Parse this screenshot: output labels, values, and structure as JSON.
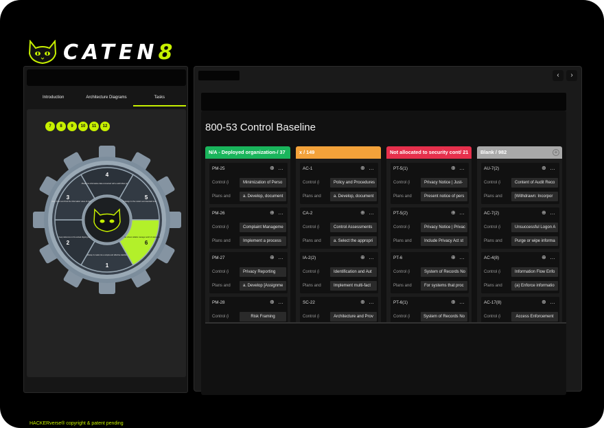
{
  "brand": {
    "name": "CATEN",
    "eight": "8"
  },
  "left_tabs": [
    "Introduction",
    "Architecture Diagrams",
    "Tasks"
  ],
  "steps": [
    "7",
    "8",
    "9",
    "10",
    "11",
    "12"
  ],
  "gear": {
    "segments": [
      {
        "num": "1",
        "text": "A tabletop & made into a simple and effective dashboard"
      },
      {
        "num": "2",
        "text": "Keep reference to the actual clipping canvas"
      },
      {
        "num": "3",
        "text": "Use, Count and Find the information value of component level"
      },
      {
        "num": "4",
        "text": "Please be informative data connected with a well follow practices"
      },
      {
        "num": "5",
        "text": "Digital design to the modern and standard tune"
      },
      {
        "num": "6",
        "text": "Create to the robust reliable manage world of relevance"
      }
    ]
  },
  "footer": "HACKERverse® copyright & patent pending",
  "nav": {
    "prev": "‹",
    "next": "›"
  },
  "baseline": {
    "title": "800-53 Control Baseline"
  },
  "colors": {
    "accent": "#c7f000",
    "green": "#1db954",
    "orange": "#f0a030",
    "red": "#e8344e",
    "gray": "#a8a8a8"
  },
  "columns": [
    {
      "title": "N/A - Deployed organization-/ 37",
      "color": "#1ab55c",
      "cards": [
        {
          "id": "PM-25",
          "control_label": "Control (i",
          "control": "Minimization of Perso",
          "plans_label": "Plans and",
          "plans": "a. Develop, document"
        },
        {
          "id": "PM-26",
          "control_label": "Control (i",
          "control": "Complaint Manageme",
          "plans_label": "Plans and",
          "plans": "Implement a process"
        },
        {
          "id": "PM-27",
          "control_label": "Control (i",
          "control": "Privacy Reporting",
          "plans_label": "Plans and",
          "plans": "a. Develop [Assignme"
        },
        {
          "id": "PM-28",
          "control_label": "Control (i",
          "control": "Risk Framing",
          "plans_label": "",
          "plans": ""
        }
      ]
    },
    {
      "title": "x / 149",
      "color": "#f3a23a",
      "cards": [
        {
          "id": "AC-1",
          "control_label": "Control (i",
          "control": "Policy and Procedures",
          "plans_label": "Plans and",
          "plans": "a. Develop, document"
        },
        {
          "id": "CA-2",
          "control_label": "Control (i",
          "control": "Control Assessments",
          "plans_label": "Plans and",
          "plans": "a. Select the appropri"
        },
        {
          "id": "IA-2(2)",
          "control_label": "Control (i",
          "control": "Identification and Aut",
          "plans_label": "Plans and",
          "plans": "Implement multi-fact"
        },
        {
          "id": "SC-22",
          "control_label": "Control (i",
          "control": "Architecture and Prov",
          "plans_label": "",
          "plans": ""
        }
      ]
    },
    {
      "title": "Not allocated to security cont/ 21",
      "color": "#e6304c",
      "cards": [
        {
          "id": "PT-5(1)",
          "control_label": "Control (i",
          "control": "Privacy Notice | Just-",
          "plans_label": "Plans and",
          "plans": "Present notice of pers"
        },
        {
          "id": "PT-5(2)",
          "control_label": "Control (i",
          "control": "Privacy Notice | Privac",
          "plans_label": "Plans and",
          "plans": "Include Privacy Act st"
        },
        {
          "id": "PT-6",
          "control_label": "Control (i",
          "control": "System of Records No",
          "plans_label": "Plans and",
          "plans": "For systems that proc"
        },
        {
          "id": "PT-6(1)",
          "control_label": "Control (i",
          "control": "System of Records No",
          "plans_label": "",
          "plans": ""
        }
      ]
    },
    {
      "title": "Blank / 982",
      "color": "#a9a9a9",
      "cards": [
        {
          "id": "AU-7(2)",
          "control_label": "Control (i",
          "control": "Content of Audit Reco",
          "plans_label": "Plans and",
          "plans": "[Withdrawn: Incorpor"
        },
        {
          "id": "AC-7(2)",
          "control_label": "Control (i",
          "control": "Unsuccessful Logon A",
          "plans_label": "Plans and",
          "plans": "Purge or wipe informa"
        },
        {
          "id": "AC-4(8)",
          "control_label": "Control (i",
          "control": "Information Flow Enfo",
          "plans_label": "Plans and",
          "plans": "(a) Enforce informatio"
        },
        {
          "id": "AC-17(8)",
          "control_label": "Control (i",
          "control": "Access Enforcement",
          "plans_label": "",
          "plans": ""
        }
      ]
    }
  ]
}
